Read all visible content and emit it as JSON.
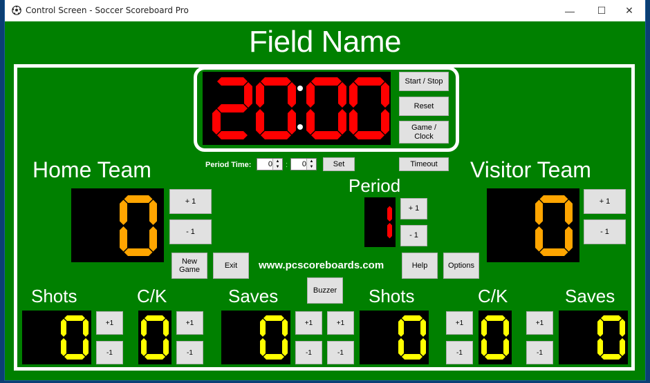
{
  "window": {
    "title": "Control Screen - Soccer Scoreboard Pro",
    "controls": {
      "minimize": "—",
      "maximize": "☐",
      "close": "✕"
    },
    "icon": "soccer-ball-icon"
  },
  "colors": {
    "background": "#008000",
    "clock_digits": "#ff0000",
    "score_digits": "#ffa500",
    "stat_digits": "#ffff00",
    "period_digit": "#ff0000"
  },
  "field_name": "Field Name",
  "clock": {
    "value": "20:00",
    "digits": [
      "2",
      "0",
      "0",
      "0"
    ],
    "buttons": {
      "start_stop": "Start / Stop",
      "reset": "Reset",
      "game_clock": "Game / Clock",
      "timeout": "Timeout"
    }
  },
  "period_time": {
    "label": "Period Time:",
    "minutes": "0",
    "separator": ":",
    "seconds": "0",
    "set_label": "Set"
  },
  "home": {
    "name": "Home Team",
    "score": "0",
    "plus": "+ 1",
    "minus": "- 1",
    "stats": {
      "shots": {
        "label": "Shots",
        "value": "0",
        "plus": "+1",
        "minus": "-1"
      },
      "ck": {
        "label": "C/K",
        "value": "0",
        "plus": "+1",
        "minus": "-1"
      },
      "saves": {
        "label": "Saves",
        "value": "0",
        "plus": "+1",
        "minus": "-1"
      }
    }
  },
  "visitor": {
    "name": "Visitor Team",
    "score": "0",
    "plus": "+ 1",
    "minus": "- 1",
    "stats": {
      "shots": {
        "label": "Shots",
        "value": "0",
        "plus": "+1",
        "minus": "-1"
      },
      "ck": {
        "label": "C/K",
        "value": "0",
        "plus": "+1",
        "minus": "-1"
      },
      "saves": {
        "label": "Saves",
        "value": "0",
        "plus": "+1",
        "minus": "-1"
      }
    }
  },
  "period": {
    "label": "Period",
    "value": "1",
    "plus": "+ 1",
    "minus": "- 1"
  },
  "actions": {
    "new_game": "New Game",
    "exit": "Exit",
    "help": "Help",
    "options": "Options",
    "buzzer": "Buzzer"
  },
  "website": "www.pcscoreboards.com"
}
